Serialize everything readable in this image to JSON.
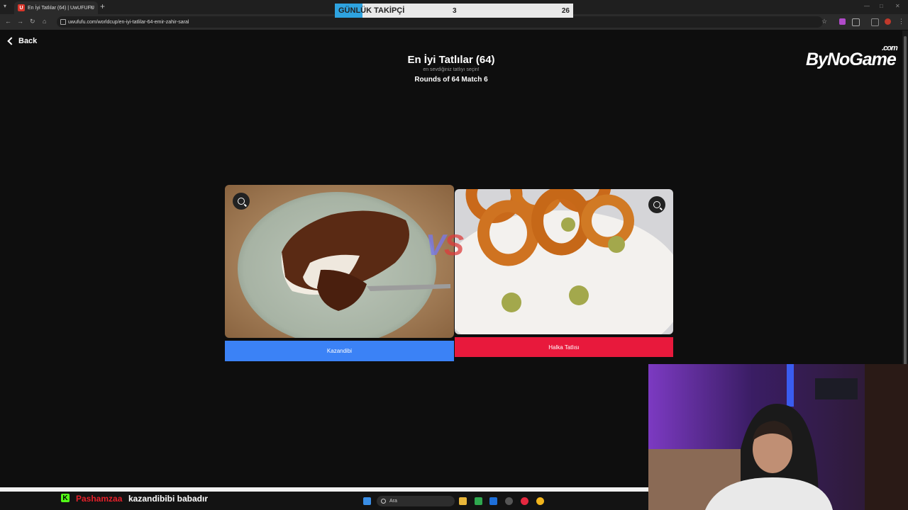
{
  "browser": {
    "tab_title": "En İyi Tatlılar (64) | UwUFUFU",
    "tab_favicon": "U",
    "tab_close": "×",
    "new_tab": "+",
    "url": "uwufufu.com/worldcup/en-iyi-tatlilar-64-emir-zahir-saral"
  },
  "follower_goal": {
    "label": "GÜNLÜK TAKİPÇİ",
    "current": "3",
    "goal": "26",
    "fill_fraction": 0.115,
    "bar_color": "#2ea3e0"
  },
  "page": {
    "back_label": "Back",
    "title": "En İyi Tatlılar (64)",
    "subtitle": "en sevdiğiniz tatlıyı seçin!",
    "round": "Rounds of 64 Match 6",
    "vs_v": "V",
    "vs_s": "S"
  },
  "brand": {
    "name": "ByNoGame",
    "suffix": ".com"
  },
  "choices": {
    "left": {
      "label": "Kazandibi",
      "color": "#3b82f6"
    },
    "right": {
      "label": "Halka Tatlısı",
      "color": "#e8193c"
    }
  },
  "chat": {
    "badge": "K",
    "username": "Pashamzaa",
    "message": "kazandibibi babadır"
  },
  "taskbar": {
    "search_placeholder": "Ara"
  },
  "icons": [
    "menu-icon",
    "favicon-icon",
    "close-icon",
    "back-icon",
    "forward-icon",
    "reload-icon",
    "home-icon",
    "lock-icon",
    "star-icon",
    "extension-icon",
    "zoom-icon",
    "chevron-left-icon",
    "windows-icon",
    "search-icon",
    "kick-icon"
  ]
}
